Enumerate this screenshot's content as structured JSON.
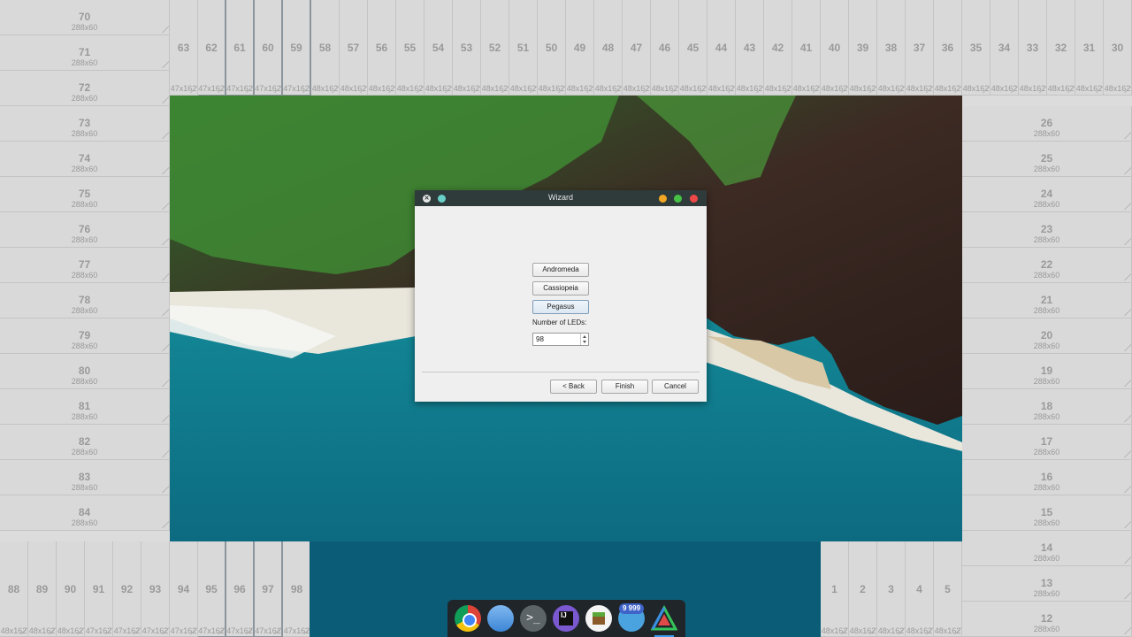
{
  "left_column": [
    {
      "num": "70",
      "size": "288x60"
    },
    {
      "num": "71",
      "size": "288x60"
    },
    {
      "num": "72",
      "size": "288x60"
    },
    {
      "num": "73",
      "size": "288x60"
    },
    {
      "num": "74",
      "size": "288x60"
    },
    {
      "num": "75",
      "size": "288x60"
    },
    {
      "num": "76",
      "size": "288x60"
    },
    {
      "num": "77",
      "size": "288x60"
    },
    {
      "num": "78",
      "size": "288x60"
    },
    {
      "num": "79",
      "size": "288x60"
    },
    {
      "num": "80",
      "size": "288x60"
    },
    {
      "num": "81",
      "size": "288x60"
    },
    {
      "num": "82",
      "size": "288x60"
    },
    {
      "num": "83",
      "size": "288x60"
    },
    {
      "num": "84",
      "size": "288x60"
    }
  ],
  "right_column": [
    {
      "num": "26",
      "size": "288x60"
    },
    {
      "num": "25",
      "size": "288x60"
    },
    {
      "num": "24",
      "size": "288x60"
    },
    {
      "num": "23",
      "size": "288x60"
    },
    {
      "num": "22",
      "size": "288x60"
    },
    {
      "num": "21",
      "size": "288x60"
    },
    {
      "num": "20",
      "size": "288x60"
    },
    {
      "num": "19",
      "size": "288x60"
    },
    {
      "num": "18",
      "size": "288x60"
    },
    {
      "num": "17",
      "size": "288x60"
    },
    {
      "num": "16",
      "size": "288x60"
    },
    {
      "num": "15",
      "size": "288x60"
    },
    {
      "num": "14",
      "size": "288x60"
    },
    {
      "num": "13",
      "size": "288x60"
    },
    {
      "num": "12",
      "size": "288x60"
    }
  ],
  "top_row": {
    "numbers": [
      "63",
      "62",
      "61",
      "60",
      "59",
      "58",
      "57",
      "56",
      "55",
      "54",
      "53",
      "52",
      "51",
      "50",
      "49",
      "48",
      "47",
      "46",
      "45",
      "44",
      "43",
      "42",
      "41",
      "40",
      "39",
      "38",
      "37",
      "36",
      "35",
      "34",
      "33",
      "32",
      "31",
      "30"
    ],
    "sizes": [
      "47x162",
      "47x162",
      "47x162",
      "47x162",
      "47x162",
      "48x162",
      "48x162",
      "48x162",
      "48x162",
      "48x162",
      "48x162",
      "48x162",
      "48x162",
      "48x162",
      "48x162",
      "48x162",
      "48x162",
      "48x162",
      "48x162",
      "48x162",
      "48x162",
      "48x162",
      "48x162",
      "48x162",
      "48x162",
      "48x162",
      "48x162",
      "48x162",
      "48x162",
      "48x162",
      "48x162",
      "48x162",
      "48x162",
      "48x162"
    ]
  },
  "bottom_left_row": {
    "numbers": [
      "88",
      "89",
      "90",
      "91",
      "92",
      "93",
      "94",
      "95",
      "96",
      "97",
      "98"
    ],
    "sizes": [
      "48x162",
      "48x162",
      "48x162",
      "47x162",
      "47x162",
      "47x162",
      "47x162",
      "47x162",
      "47x162",
      "47x162",
      "47x162"
    ]
  },
  "bottom_right_row": {
    "numbers": [
      "1",
      "2",
      "3",
      "4",
      "5"
    ],
    "sizes": [
      "48x162",
      "48x162",
      "48x162",
      "48x162",
      "48x162"
    ]
  },
  "window": {
    "title": "Wizard",
    "options": [
      "Andromeda",
      "Cassiopeia",
      "Pegasus"
    ],
    "selected_option": "Pegasus",
    "led_label": "Number of LEDs:",
    "led_value": "98",
    "back_label": "< Back",
    "finish_label": "Finish",
    "cancel_label": "Cancel"
  },
  "dock": {
    "icons": [
      "chrome-icon",
      "files-icon",
      "terminal-icon",
      "intellij-icon",
      "minecraft-icon",
      "telegram-icon",
      "triangle-app-icon"
    ],
    "terminal_glyph": ">_",
    "intellij_glyph": "IJ",
    "telegram_badge": "9 999"
  },
  "colors": {
    "titlebar": "#2f3b3b",
    "close": "#ef4848",
    "maximize": "#46c344",
    "minimize": "#f2a623",
    "pin": "#67d1c8",
    "dock": "#20252a"
  }
}
